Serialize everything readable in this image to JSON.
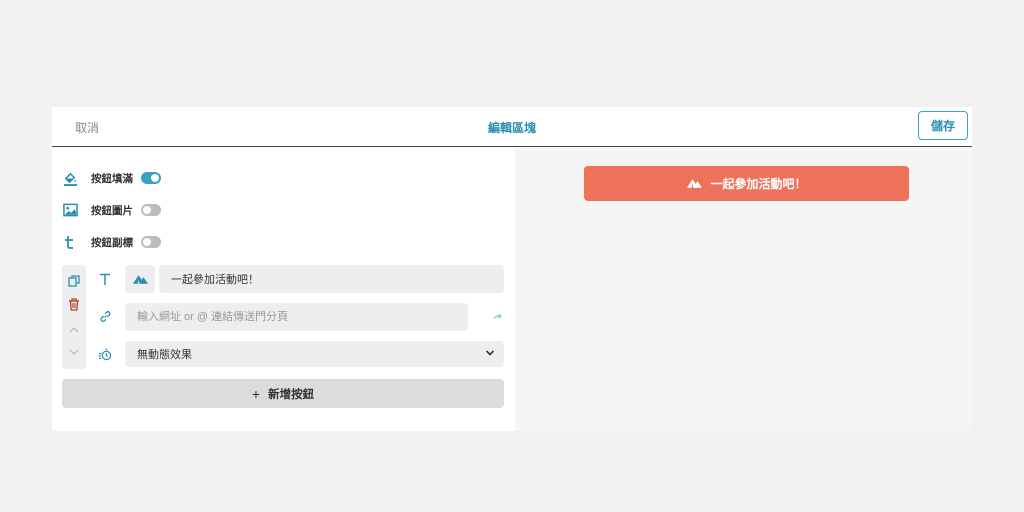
{
  "header": {
    "cancel_label": "取消",
    "title": "編輯區塊",
    "save_label": "儲存"
  },
  "options": [
    {
      "label": "按鈕填滿",
      "enabled": true,
      "icon": "paint-bucket-icon"
    },
    {
      "label": "按鈕圖片",
      "enabled": false,
      "icon": "image-icon"
    },
    {
      "label": "按鈕副標",
      "enabled": false,
      "icon": "subtitle-t-icon"
    }
  ],
  "editor": {
    "button_text": "一起參加活動吧！",
    "link_placeholder": "輸入網址 or @ 連結傳送門分頁",
    "animation_value": "無動態效果"
  },
  "add_button_label": "新增按鈕",
  "preview": {
    "button_text": "一起參加活動吧！"
  },
  "colors": {
    "accent": "#3aa3c3",
    "preview_button": "#ef725b",
    "delete": "#c0392b"
  }
}
